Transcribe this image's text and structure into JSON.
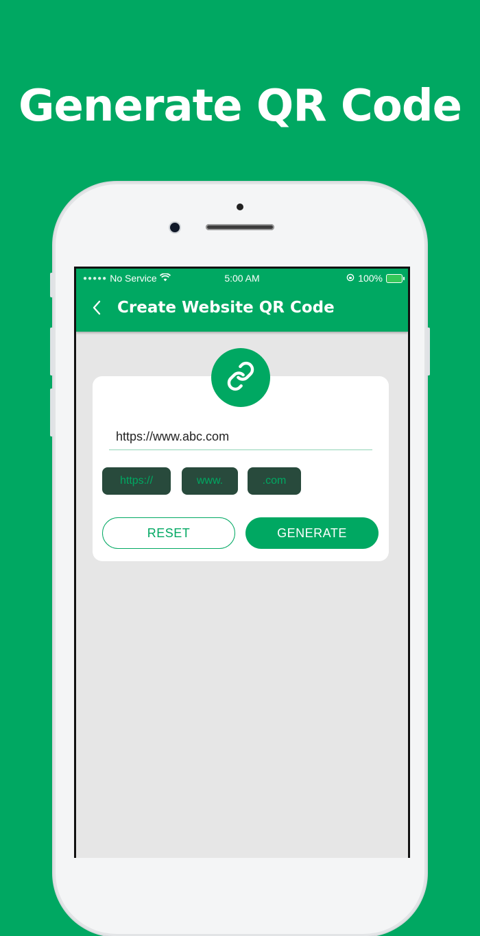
{
  "headline": "Generate QR Code",
  "colors": {
    "brand": "#00a862",
    "chip_bg": "#284a3c",
    "screen_bg": "#e6e6e6"
  },
  "status_bar": {
    "carrier": "No Service",
    "time": "5:00 AM",
    "battery": "100%"
  },
  "app_bar": {
    "title": "Create Website QR Code",
    "back_icon": "chevron-left-icon"
  },
  "form": {
    "badge_icon": "link-icon",
    "url_value": "https://www.abc.com",
    "chips": [
      "https://",
      "www.",
      ".com"
    ],
    "reset_label": "RESET",
    "generate_label": "GENERATE"
  }
}
